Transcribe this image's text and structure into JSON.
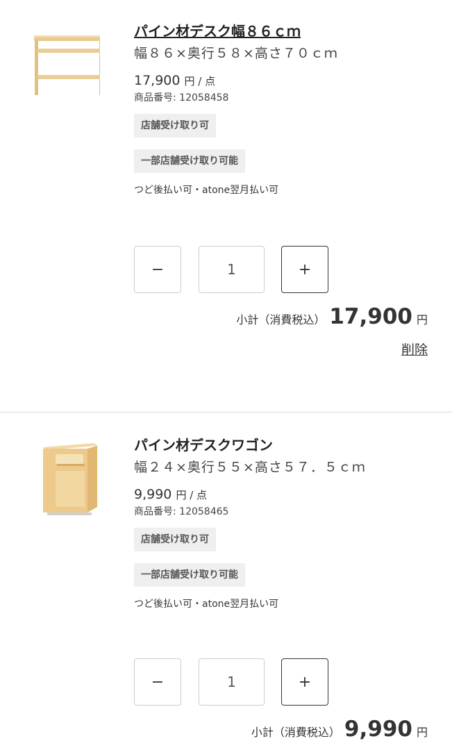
{
  "items": [
    {
      "name": "パイン材デスク幅８６ｃｍ",
      "spec": "幅８６×奥行５８×高さ７０ｃｍ",
      "price": "17,900",
      "price_unit": "円 / 点",
      "sku": "商品番号: 12058458",
      "badge_store": "店舗受け取り可",
      "badge_partial": "一部店舗受け取り可能",
      "payment": "つど後払い可・atone翌月払い可",
      "quantity": "1",
      "minus_label": "−",
      "plus_label": "+",
      "subtotal_label": "小計（消費税込）",
      "subtotal_amount": "17,900",
      "subtotal_yen": "円",
      "delete_label": "削除"
    },
    {
      "name": "パイン材デスクワゴン",
      "spec": "幅２４×奥行５５×高さ５７．５ｃｍ",
      "price": "9,990",
      "price_unit": "円 / 点",
      "sku": "商品番号: 12058465",
      "badge_store": "店舗受け取り可",
      "badge_partial": "一部店舗受け取り可能",
      "payment": "つど後払い可・atone翌月払い可",
      "quantity": "1",
      "minus_label": "−",
      "plus_label": "+",
      "subtotal_label": "小計（消費税込）",
      "subtotal_amount": "9,990",
      "subtotal_yen": "円"
    }
  ]
}
